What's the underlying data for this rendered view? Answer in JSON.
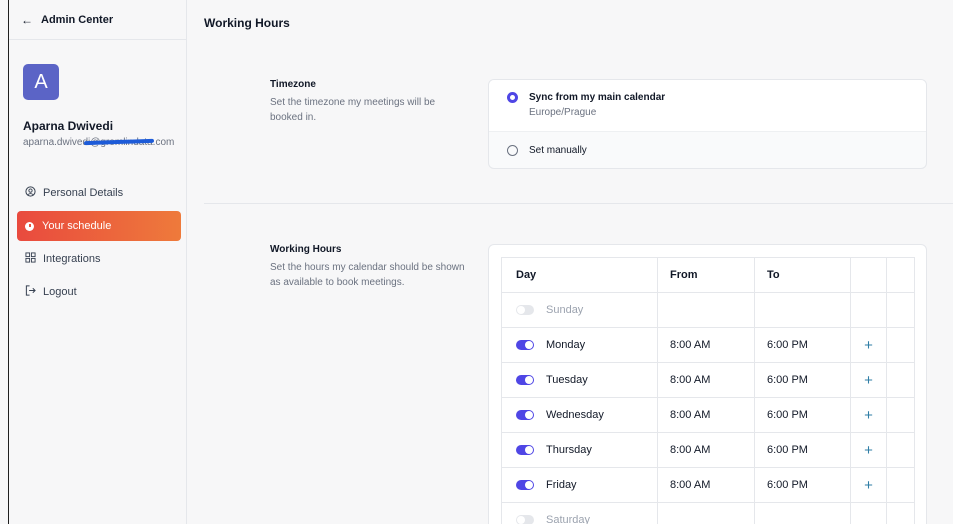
{
  "sidebar": {
    "back_label": "Admin Center",
    "avatar_letter": "A",
    "user_name": "Aparna Dwivedi",
    "user_email": "aparna.dwivedi@gremlindata.com",
    "nav": [
      {
        "label": "Personal Details",
        "icon": "user-circle-icon"
      },
      {
        "label": "Your schedule",
        "icon": "clock-icon"
      },
      {
        "label": "Integrations",
        "icon": "grid-icon"
      },
      {
        "label": "Logout",
        "icon": "logout-icon"
      }
    ]
  },
  "main": {
    "title": "Working Hours",
    "timezone": {
      "title": "Timezone",
      "desc": "Set the timezone my meetings will be booked in.",
      "option1": "Sync from my main calendar",
      "option1_sub": "Europe/Prague",
      "option2": "Set manually",
      "selected": "option1"
    },
    "working_hours": {
      "title": "Working Hours",
      "desc": "Set the hours my calendar should be shown as available to book meetings.",
      "headers": {
        "day": "Day",
        "from": "From",
        "to": "To"
      },
      "days": [
        {
          "name": "Sunday",
          "enabled": false,
          "from": "",
          "to": ""
        },
        {
          "name": "Monday",
          "enabled": true,
          "from": "8:00 AM",
          "to": "6:00 PM"
        },
        {
          "name": "Tuesday",
          "enabled": true,
          "from": "8:00 AM",
          "to": "6:00 PM"
        },
        {
          "name": "Wednesday",
          "enabled": true,
          "from": "8:00 AM",
          "to": "6:00 PM"
        },
        {
          "name": "Thursday",
          "enabled": true,
          "from": "8:00 AM",
          "to": "6:00 PM"
        },
        {
          "name": "Friday",
          "enabled": true,
          "from": "8:00 AM",
          "to": "6:00 PM"
        },
        {
          "name": "Saturday",
          "enabled": false,
          "from": "",
          "to": ""
        }
      ],
      "add_glyph": "+"
    }
  },
  "colors": {
    "accent": "#4f46e5",
    "active_nav_start": "#e94a3e",
    "active_nav_end": "#ee7a3b",
    "avatar": "#5b64c6",
    "plus": "#2f7ea6"
  }
}
